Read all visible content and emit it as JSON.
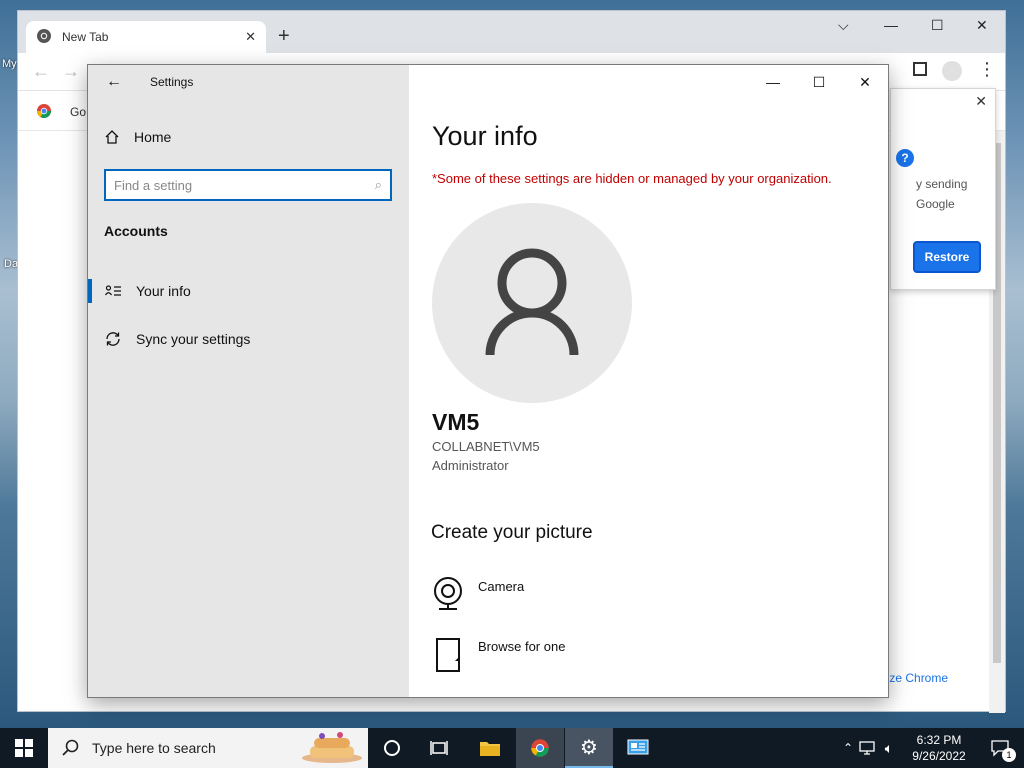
{
  "desktop": {
    "labels": [
      "My",
      "Da"
    ]
  },
  "chrome": {
    "tab_title": "New Tab",
    "bookmark_partial": "Go",
    "popup_text_1": "y sending",
    "popup_text_2": "Google",
    "restore_label": "Restore",
    "customize_partial": "nize Chrome",
    "colors": {
      "accent": "#1a73e8",
      "tabbar": "#dee1e6"
    }
  },
  "settings": {
    "window_title": "Settings",
    "home_label": "Home",
    "search_placeholder": "Find a setting",
    "section_title": "Accounts",
    "nav": [
      {
        "label": "Your info",
        "icon": "person-list-icon",
        "active": true
      },
      {
        "label": "Sync your settings",
        "icon": "sync-icon",
        "active": false
      }
    ],
    "page_title": "Your info",
    "warning": "*Some of these settings are hidden or managed by your organization.",
    "user": {
      "name": "VM5",
      "account": "COLLABNET\\VM5",
      "role": "Administrator"
    },
    "create_picture_title": "Create your picture",
    "picture_options": [
      {
        "label": "Camera",
        "icon": "camera-icon"
      },
      {
        "label": "Browse for one",
        "icon": "file-icon"
      }
    ],
    "colors": {
      "accent": "#0067c0",
      "warning": "#c00000",
      "sidebar": "#e6e6e6"
    }
  },
  "taskbar": {
    "search_placeholder": "Type here to search",
    "time": "6:32 PM",
    "date": "9/26/2022",
    "notification_count": "1"
  }
}
